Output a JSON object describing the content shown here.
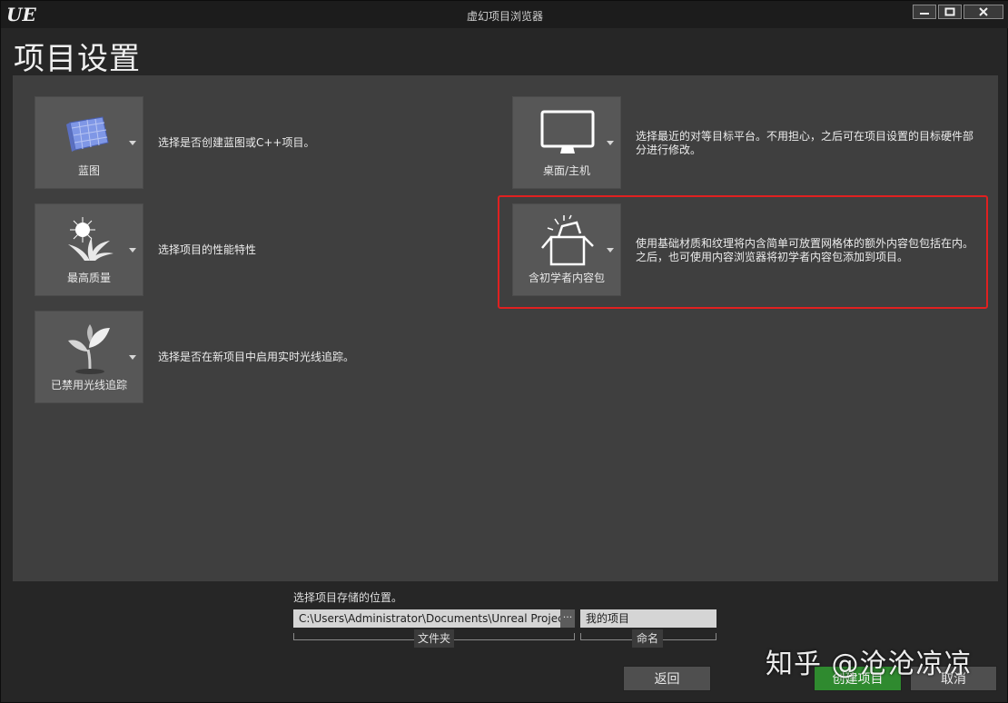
{
  "window": {
    "title": "虚幻项目浏览器",
    "logo": "UE"
  },
  "page": {
    "title": "项目设置"
  },
  "options": [
    {
      "label": "蓝图",
      "icon": "blueprint-icon",
      "description": "选择是否创建蓝图或C++项目。"
    },
    {
      "label": "最高质量",
      "icon": "quality-plant-icon",
      "description": "选择项目的性能特性"
    },
    {
      "label": "已禁用光线追踪",
      "icon": "raytracing-sprout-icon",
      "description": "选择是否在新项目中启用实时光线追踪。"
    },
    {
      "label": "桌面/主机",
      "icon": "monitor-icon",
      "description_lines": [
        "选择最近的对等目标平台。不用担心，之后可在项目设置的目标硬件部",
        "分进行修改。"
      ]
    },
    {
      "label": "含初学者内容包",
      "icon": "starter-box-icon",
      "description_lines": [
        "使用基础材质和纹理将内含简单可放置网格体的额外内容包包括在内。",
        "之后，也可使用内容浏览器将初学者内容包添加到项目。"
      ]
    }
  ],
  "location": {
    "label": "选择项目存储的位置。",
    "path": "C:\\Users\\Administrator\\Documents\\Unreal Projects",
    "browse": "···",
    "folder_tag": "文件夹",
    "name_value": "我的项目",
    "name_tag": "命名"
  },
  "buttons": {
    "back": "返回",
    "create": "创建项目",
    "cancel": "取消"
  },
  "watermark": "知乎 @沧沧凉凉",
  "colors": {
    "accent_green": "#2f8a2f",
    "highlight_red": "#e02020",
    "panel": "#3f3f3f"
  }
}
